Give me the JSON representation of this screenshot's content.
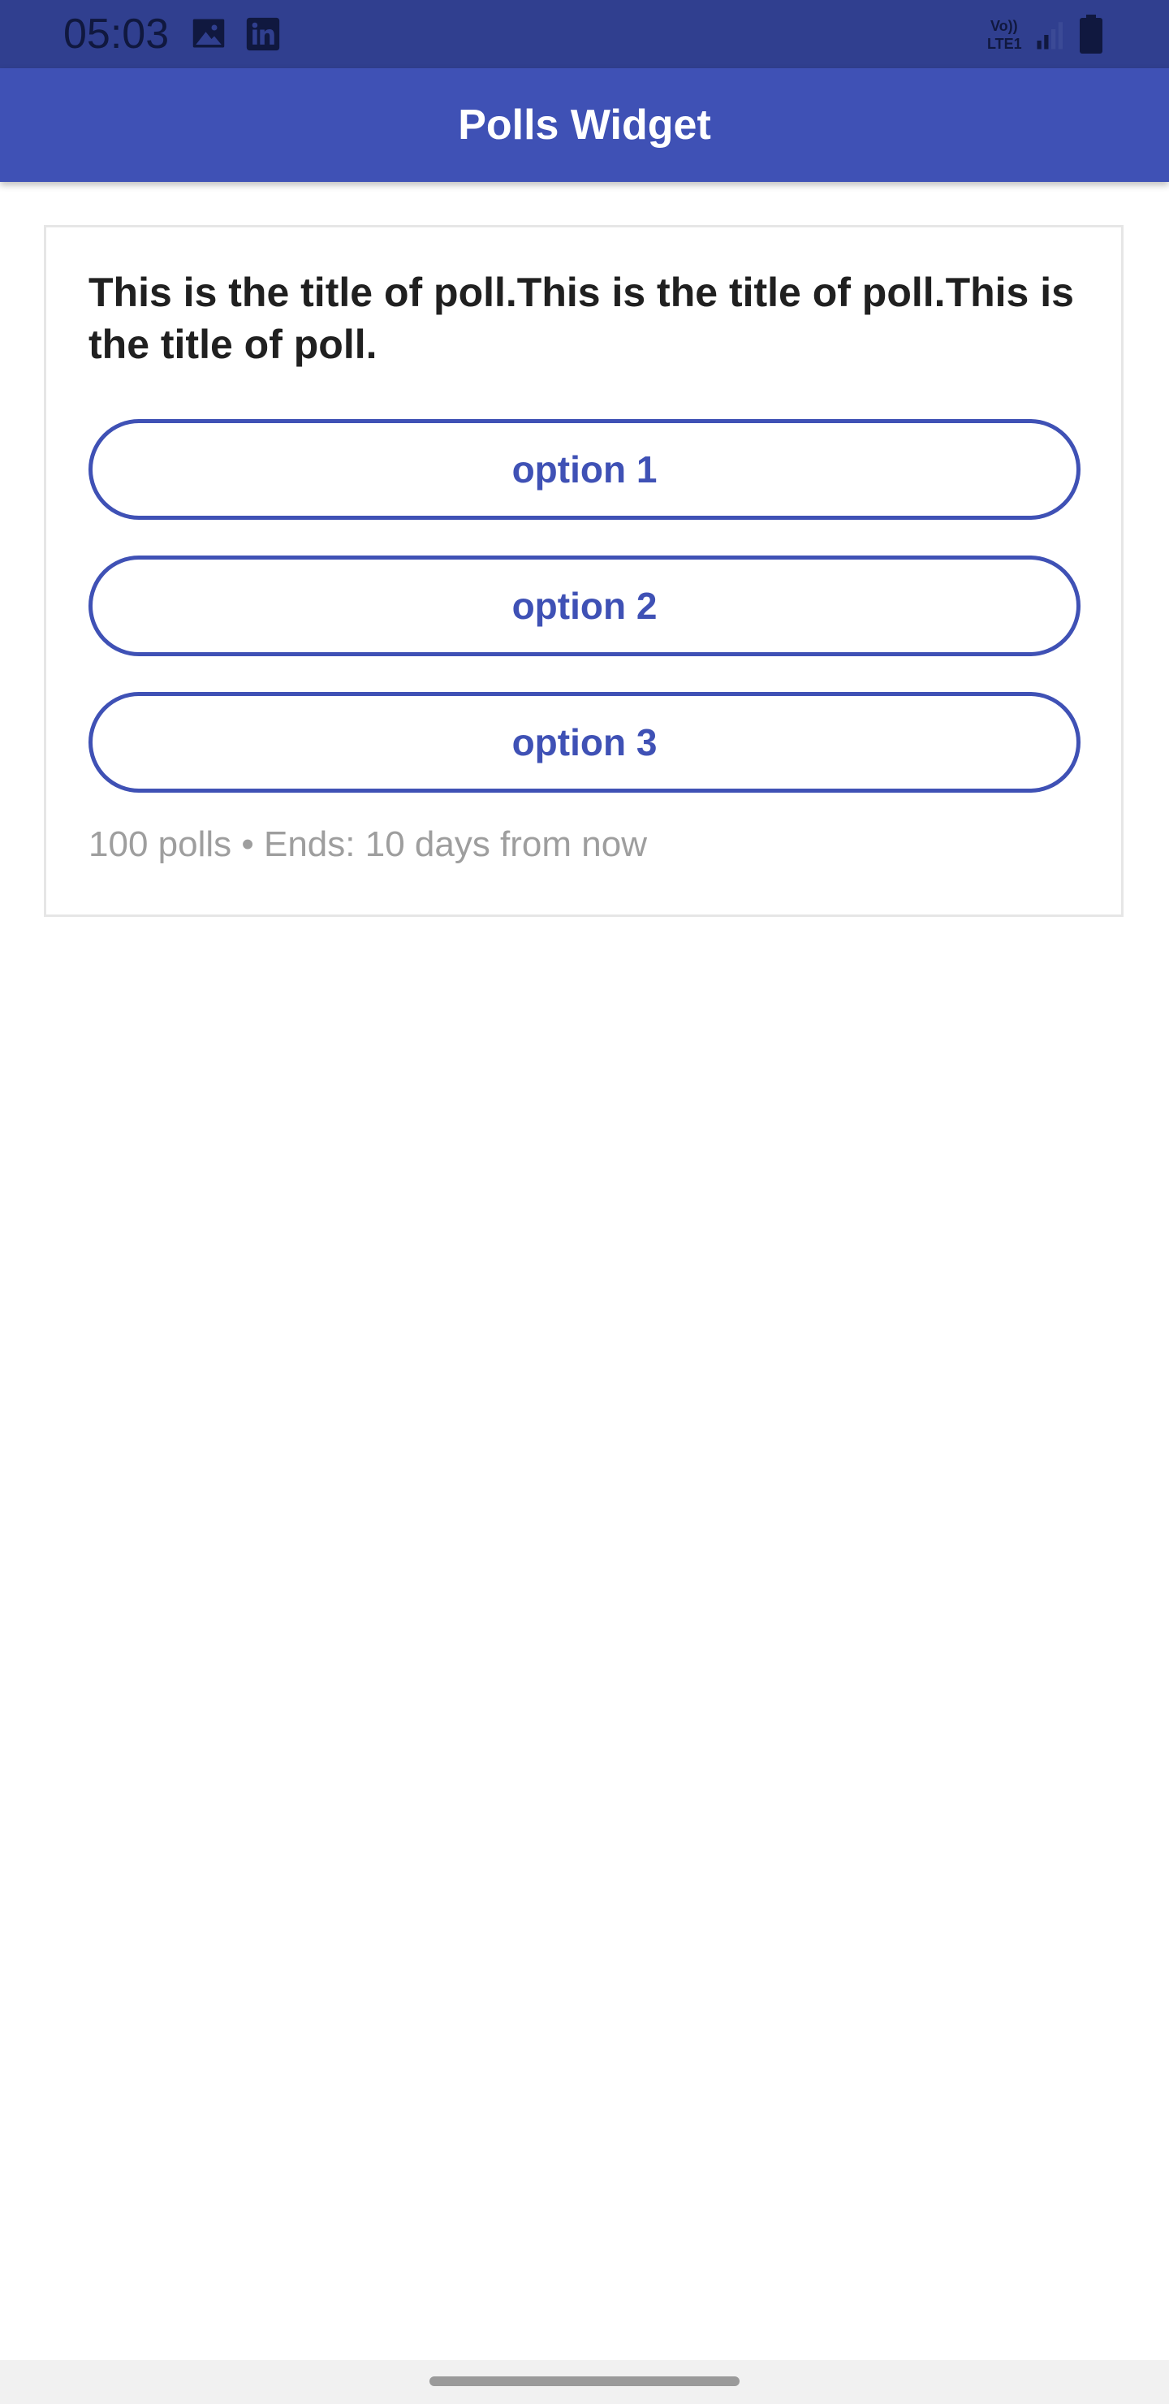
{
  "status_bar": {
    "time": "05:03",
    "icons": [
      "image-icon",
      "linkedin-icon",
      "volte-icon",
      "signal-icon",
      "battery-icon"
    ],
    "volte_text": "Vo))\nLTE1"
  },
  "app_bar": {
    "title": "Polls Widget",
    "color": "#3f51b5"
  },
  "poll": {
    "title": "This is the title of poll.This is the title of poll.This is the title of poll.",
    "options": [
      {
        "label": "option 1"
      },
      {
        "label": "option 2"
      },
      {
        "label": "option 3"
      }
    ],
    "meta": "100 polls • Ends: 10 days from now",
    "accent_color": "#3f51b5"
  }
}
